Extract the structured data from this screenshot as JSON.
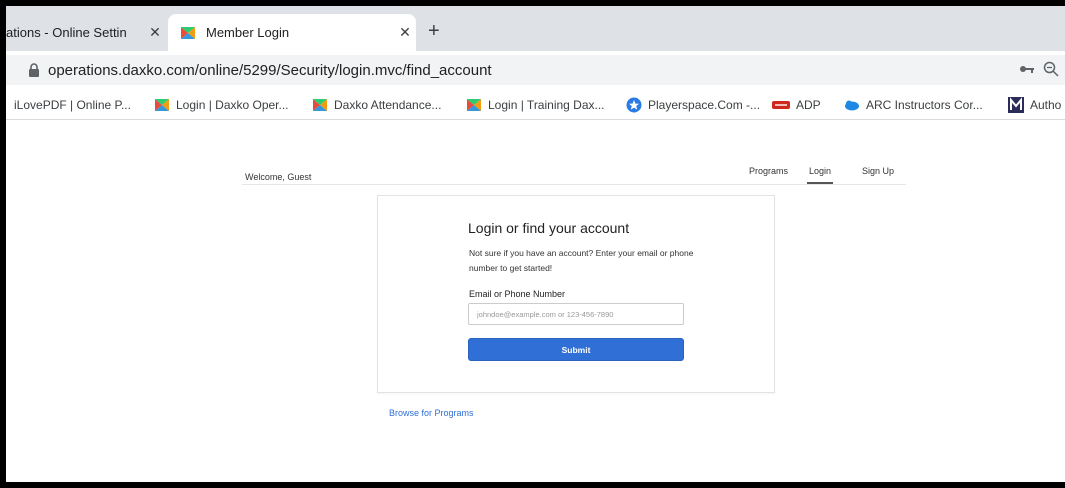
{
  "tabs": [
    {
      "title": "ations - Online Settin",
      "close": "✕",
      "active": false
    },
    {
      "title": "Member Login",
      "close": "✕",
      "active": true
    }
  ],
  "new_tab_glyph": "+",
  "address_bar": {
    "url": "operations.daxko.com/online/5299/Security/login.mvc/find_account"
  },
  "bookmarks": [
    {
      "label": "iLovePDF | Online P...",
      "icon": "none"
    },
    {
      "label": "Login | Daxko Oper...",
      "icon": "daxko-icon"
    },
    {
      "label": "Daxko Attendance...",
      "icon": "daxko-icon"
    },
    {
      "label": "Login | Training Dax...",
      "icon": "daxko-icon"
    },
    {
      "label": "Playerspace.Com -...",
      "icon": "playerspace-icon"
    },
    {
      "label": "ADP",
      "icon": "adp-icon"
    },
    {
      "label": "ARC Instructors Cor...",
      "icon": "arc-icon"
    },
    {
      "label": "Autho",
      "icon": "m-icon"
    }
  ],
  "page": {
    "welcome": "Welcome, Guest",
    "nav": {
      "programs": "Programs",
      "login": "Login",
      "signup": "Sign Up"
    },
    "panel": {
      "title": "Login or find your account",
      "description": "Not sure if you have an account? Enter your email or phone number to get started!",
      "field_label": "Email or Phone Number",
      "field_placeholder": "johndoe@example.com or 123-456-7890",
      "field_value": "",
      "submit_label": "Submit"
    },
    "browse_link": "Browse for Programs"
  },
  "colors": {
    "accent": "#2f6fd6",
    "tab_strip": "#dee1e6",
    "omnibox": "#f1f3f4"
  }
}
